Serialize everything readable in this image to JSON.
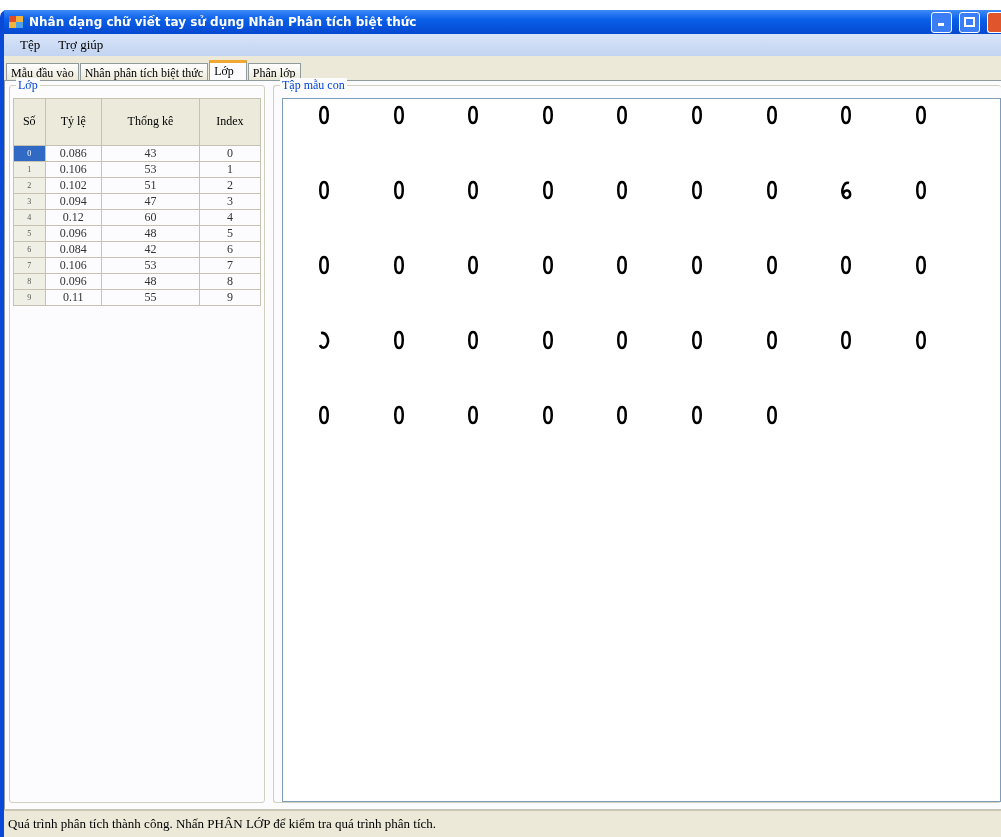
{
  "window": {
    "title": "Nhân dạng chữ viết tay sử dụng Nhân Phân tích biệt thức"
  },
  "menu": [
    "Tệp",
    "Trợ giúp"
  ],
  "tabs": [
    {
      "label": "Mẫu đầu vào",
      "selected": false
    },
    {
      "label": "Nhân phân tích biệt thức",
      "selected": false
    },
    {
      "label": "Lớp",
      "selected": true
    },
    {
      "label": "Phân lớp",
      "selected": false
    }
  ],
  "class_group": {
    "title": "Lớp",
    "columns": [
      "Số",
      "Tỷ lệ",
      "Thống kê",
      "Index"
    ],
    "rows": [
      {
        "number": "0",
        "ratio": "0.086",
        "count": "43",
        "index": "0",
        "selected": true
      },
      {
        "number": "1",
        "ratio": "0.106",
        "count": "53",
        "index": "1",
        "selected": false
      },
      {
        "number": "2",
        "ratio": "0.102",
        "count": "51",
        "index": "2",
        "selected": false
      },
      {
        "number": "3",
        "ratio": "0.094",
        "count": "47",
        "index": "3",
        "selected": false
      },
      {
        "number": "4",
        "ratio": "0.12",
        "count": "60",
        "index": "4",
        "selected": false
      },
      {
        "number": "5",
        "ratio": "0.096",
        "count": "48",
        "index": "5",
        "selected": false
      },
      {
        "number": "6",
        "ratio": "0.084",
        "count": "42",
        "index": "6",
        "selected": false
      },
      {
        "number": "7",
        "ratio": "0.106",
        "count": "53",
        "index": "7",
        "selected": false
      },
      {
        "number": "8",
        "ratio": "0.096",
        "count": "48",
        "index": "8",
        "selected": false
      },
      {
        "number": "9",
        "ratio": "0.11",
        "count": "55",
        "index": "9",
        "selected": false
      }
    ]
  },
  "sample_group": {
    "title": "Tập mẫu con",
    "samples": [
      {
        "kind": "zero"
      },
      {
        "kind": "zero"
      },
      {
        "kind": "zero"
      },
      {
        "kind": "zero"
      },
      {
        "kind": "zero"
      },
      {
        "kind": "zero"
      },
      {
        "kind": "zero"
      },
      {
        "kind": "zero"
      },
      {
        "kind": "zero"
      },
      {
        "kind": "zero"
      },
      {
        "kind": "zero"
      },
      {
        "kind": "zero"
      },
      {
        "kind": "zero"
      },
      {
        "kind": "zero"
      },
      {
        "kind": "zero"
      },
      {
        "kind": "zero"
      },
      {
        "kind": "six"
      },
      {
        "kind": "zero"
      },
      {
        "kind": "zero"
      },
      {
        "kind": "zero"
      },
      {
        "kind": "zero"
      },
      {
        "kind": "zero"
      },
      {
        "kind": "zero"
      },
      {
        "kind": "zero"
      },
      {
        "kind": "zero"
      },
      {
        "kind": "zero"
      },
      {
        "kind": "zero"
      },
      {
        "kind": "open"
      },
      {
        "kind": "zero"
      },
      {
        "kind": "zero"
      },
      {
        "kind": "zero"
      },
      {
        "kind": "zero"
      },
      {
        "kind": "zero"
      },
      {
        "kind": "zero"
      },
      {
        "kind": "zero"
      },
      {
        "kind": "zero"
      },
      {
        "kind": "zero"
      },
      {
        "kind": "zero"
      },
      {
        "kind": "zero"
      },
      {
        "kind": "zero"
      },
      {
        "kind": "zero"
      },
      {
        "kind": "zero"
      },
      {
        "kind": "zero"
      }
    ]
  },
  "status_bar": "Quá trình phân tích thành công. Nhấn PHÂN LỚP để kiểm tra quá trình phân tích."
}
